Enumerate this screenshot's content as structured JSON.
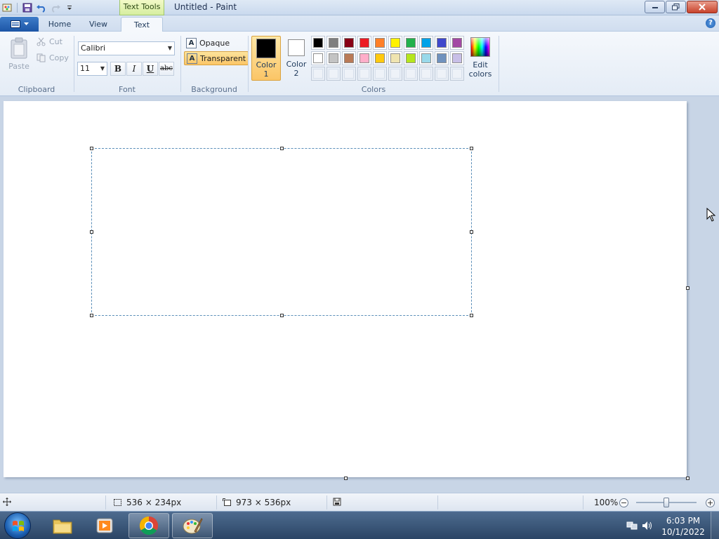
{
  "window": {
    "title": "Untitled - Paint",
    "contextual_tab": "Text Tools"
  },
  "tabs": [
    {
      "label": "Home"
    },
    {
      "label": "View"
    },
    {
      "label": "Text",
      "active": true
    }
  ],
  "help_label": "?",
  "clipboard": {
    "paste": "Paste",
    "cut": "Cut",
    "copy": "Copy",
    "group_label": "Clipboard"
  },
  "font": {
    "family": "Calibri",
    "size": "11",
    "bold": "B",
    "italic": "I",
    "underline": "U",
    "strikethrough": "abc",
    "group_label": "Font"
  },
  "background": {
    "opaque": "Opaque",
    "transparent": "Transparent",
    "selected": "Transparent",
    "group_label": "Background"
  },
  "colors": {
    "color1_label_1": "Color",
    "color1_label_2": "1",
    "color2_label_1": "Color",
    "color2_label_2": "2",
    "color1_value": "#000000",
    "color2_value": "#ffffff",
    "edit_label_1": "Edit",
    "edit_label_2": "colors",
    "group_label": "Colors",
    "palette_row1": [
      "#000000",
      "#7f7f7f",
      "#880015",
      "#ed1c24",
      "#ff7f27",
      "#fff200",
      "#22b14c",
      "#00a2e8",
      "#3f48cc",
      "#a349a4"
    ],
    "palette_row2": [
      "#ffffff",
      "#c3c3c3",
      "#b97a57",
      "#ffaec9",
      "#ffc90e",
      "#efe4b0",
      "#b5e61d",
      "#99d9ea",
      "#7092be",
      "#c8bfe7"
    ]
  },
  "status": {
    "selection_size": "536 × 234px",
    "canvas_size": "973 × 536px",
    "zoom": "100%",
    "zoom_fraction": 0.5
  },
  "taskbar": {
    "time": "6:03 PM",
    "date": "10/1/2022"
  }
}
